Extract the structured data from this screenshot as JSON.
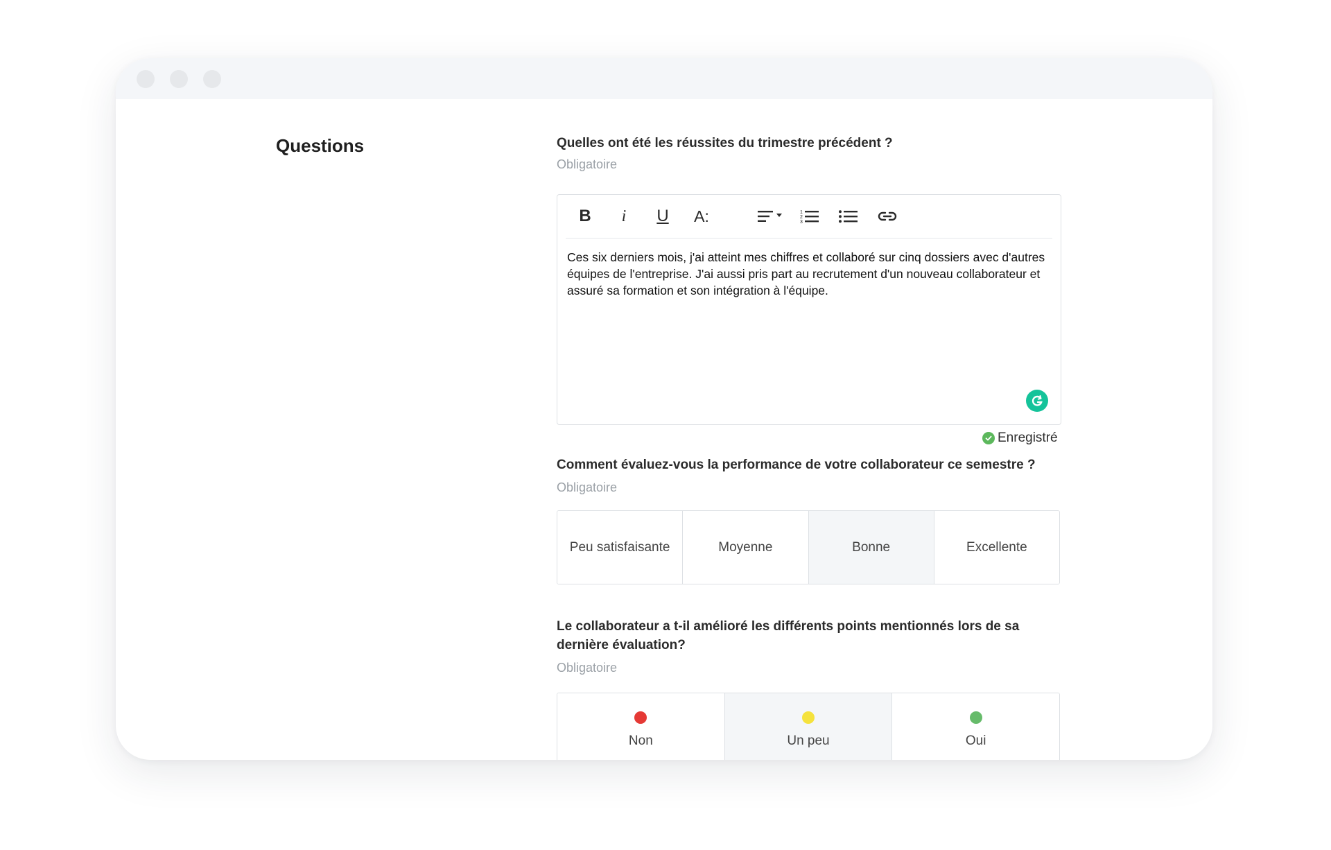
{
  "section": {
    "title": "Questions"
  },
  "question1": {
    "title": "Quelles ont été les réussites du trimestre précédent ?",
    "required": "Obligatoire",
    "answer": "Ces six derniers mois, j'ai atteint mes chiffres et collaboré sur cinq dossiers avec d'autres équipes de l'entreprise. J'ai aussi pris part au recrutement d'un nouveau collaborateur et assuré sa formation et son intégration à l'équipe.",
    "toolbar": {
      "bold_label": "B",
      "italic_label": "i",
      "underline_label": "U",
      "fontsize_label": "A:"
    },
    "saved_label": "Enregistré"
  },
  "question2": {
    "title": "Comment évaluez-vous la performance de votre collaborateur ce semestre ?",
    "required": "Obligatoire",
    "options": [
      "Peu satisfaisante",
      "Moyenne",
      "Bonne",
      "Excellente"
    ],
    "selected": "Bonne"
  },
  "question3": {
    "title": "Le collaborateur a t-il amélioré les différents points mentionnés lors de sa dernière évaluation?",
    "required": "Obligatoire",
    "options": [
      {
        "label": "Non",
        "color": "#e53935"
      },
      {
        "label": "Un peu",
        "color": "#f5e23d"
      },
      {
        "label": "Oui",
        "color": "#66bb6a"
      }
    ],
    "selected": "Un peu"
  },
  "colors": {
    "grammarly": "#15c39a",
    "saved_check": "#5cb85c",
    "selected_bg": "#f4f6f8"
  }
}
